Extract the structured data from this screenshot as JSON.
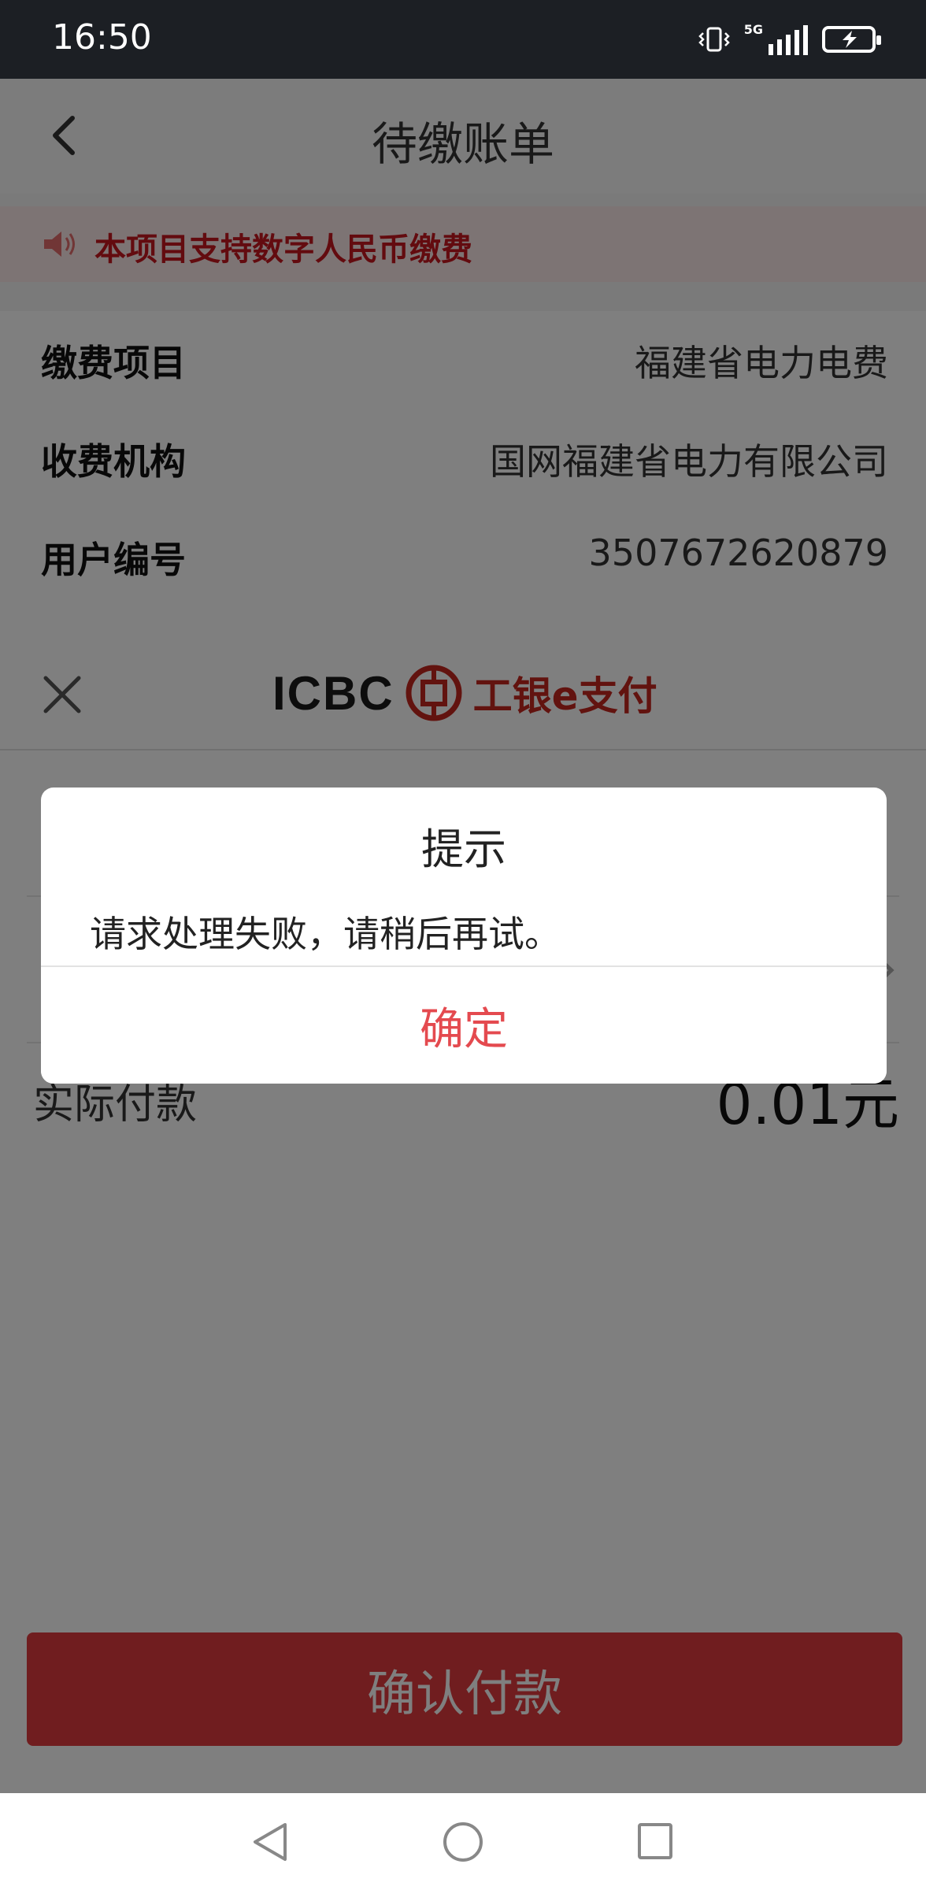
{
  "status_bar": {
    "time": "16:50",
    "network_label": "5G"
  },
  "header": {
    "title": "待缴账单"
  },
  "notice": {
    "text": "本项目支持数字人民币缴费"
  },
  "bill_info": [
    {
      "label": "缴费项目",
      "value": "福建省电力电费"
    },
    {
      "label": "收费机构",
      "value": "国网福建省电力有限公司"
    },
    {
      "label": "用户编号",
      "value": "3507672620879"
    }
  ],
  "pay_sheet": {
    "brand_icbc": "ICBC",
    "brand_pay": "工银e支付",
    "amount_label": "实际付款",
    "amount_value": "0.01元",
    "confirm_button": "确认付款"
  },
  "dialog": {
    "title": "提示",
    "message": "请求处理失败，请稍后再试。",
    "ok_button": "确定"
  },
  "colors": {
    "accent_red": "#e03a3e",
    "notice_red": "#c7161e"
  }
}
